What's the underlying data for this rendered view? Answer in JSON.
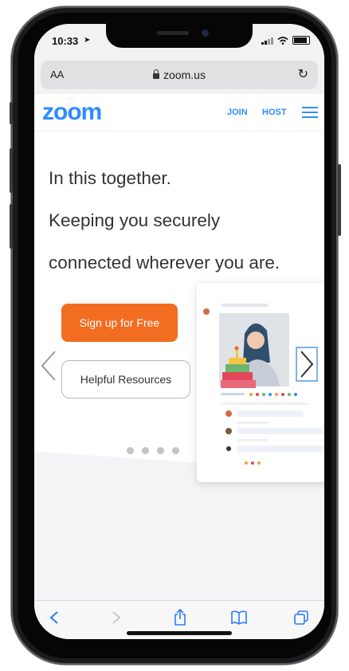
{
  "status_bar": {
    "time": "10:33"
  },
  "browser": {
    "text_size_label": "AA",
    "url": "zoom.us"
  },
  "site_header": {
    "logo": "zoom",
    "nav": [
      {
        "label": "JOIN"
      },
      {
        "label": "HOST"
      }
    ]
  },
  "hero": {
    "lines": [
      "In this together.",
      "Keeping you securely",
      "connected wherever you are."
    ],
    "signup_label": "Sign up for Free",
    "resources_label": "Helpful Resources",
    "carousel_pages": 4
  },
  "colors": {
    "brand_blue": "#2d8cff",
    "cta_orange": "#f26d21"
  },
  "toolbar_icons": [
    "back-icon",
    "forward-icon",
    "share-icon",
    "bookmarks-icon",
    "tabs-icon"
  ]
}
